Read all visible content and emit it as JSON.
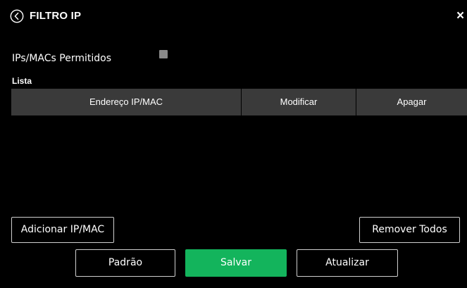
{
  "header": {
    "title": "FILTRO IP",
    "back_icon": "chevron-left-circle-icon",
    "close_label": "×"
  },
  "settings": {
    "permitted_label": "IPs/MACs Permitidos",
    "permitted_checked": false
  },
  "list": {
    "section_label": "Lista",
    "columns": [
      "Endereço IP/MAC",
      "Modificar",
      "Apagar"
    ],
    "rows": []
  },
  "actions": {
    "add_label": "Adicionar IP/MAC",
    "remove_all_label": "Remover Todos"
  },
  "footer": {
    "default_label": "Padrão",
    "save_label": "Salvar",
    "refresh_label": "Atualizar"
  },
  "colors": {
    "background": "#000000",
    "header_cell": "#3a3a3a",
    "checkbox": "#8a8a8a",
    "save_button": "#13b45c",
    "text": "#ffffff"
  }
}
